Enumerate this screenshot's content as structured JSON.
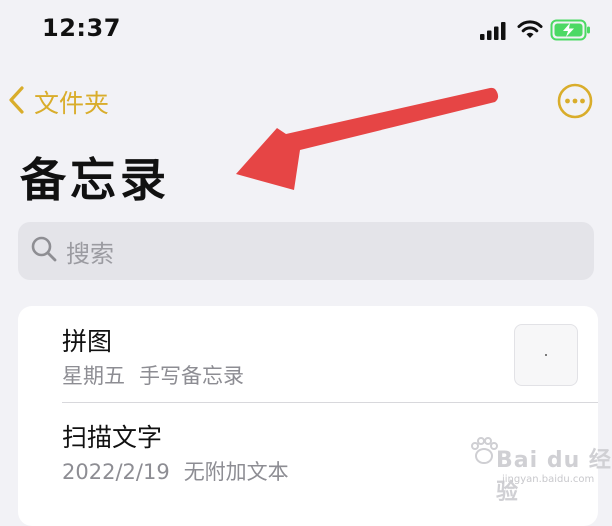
{
  "status_bar": {
    "time": "12:37",
    "signal_icon": "cellular-signal-icon",
    "wifi_icon": "wifi-icon",
    "battery_icon": "battery-charging-icon",
    "battery_color": "#4cd964"
  },
  "nav": {
    "back_label": "文件夹",
    "back_icon": "chevron-left-icon",
    "more_icon": "ellipsis-circle-icon",
    "accent_color": "#d9ad2b"
  },
  "page": {
    "title": "备忘录"
  },
  "search": {
    "placeholder": "搜索",
    "icon": "search-icon"
  },
  "notes": [
    {
      "title": "拼图",
      "date": "星期五",
      "detail": "手写备忘录",
      "has_thumbnail": true
    },
    {
      "title": "扫描文字",
      "date": "2022/2/19",
      "detail": "无附加文本",
      "has_thumbnail": false
    }
  ],
  "annotation": {
    "icon": "red-arrow-icon",
    "color": "#e64545"
  },
  "watermark": {
    "text": "Bai du 经验",
    "url": "jingyan.baidu.com"
  }
}
